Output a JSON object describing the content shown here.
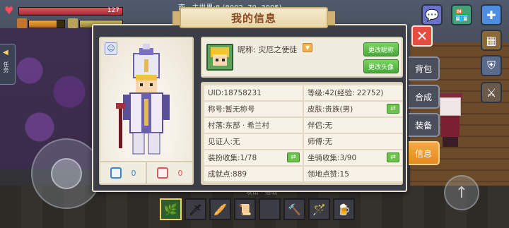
{
  "hud": {
    "hp_value": "127",
    "world_text": "南 · 主世界:8 (8002, 70, 3905)",
    "left_tab_label": "任务",
    "hotbar_label": "攻击 · 拾取"
  },
  "dialog": {
    "title": "我的信息",
    "close_label": "✕"
  },
  "profile": {
    "nickname_label": "昵称:",
    "nickname": "灾厄之使徒",
    "change_nickname_btn": "更改昵称",
    "change_avatar_btn": "更改头像"
  },
  "character": {
    "likes": "0",
    "dislikes": "0"
  },
  "info_left": [
    {
      "label": "UID:",
      "value": "18758231"
    },
    {
      "label": "称号:",
      "value": "暂无称号"
    },
    {
      "label": "村落:",
      "value": "东部 · 希兰村"
    },
    {
      "label": "见证人:",
      "value": "无"
    },
    {
      "label": "装扮收集:",
      "value": "1/78"
    },
    {
      "label": "成就点:",
      "value": "889"
    }
  ],
  "info_right": [
    {
      "label": "等级:",
      "value": "42(经验: 22752)"
    },
    {
      "label": "皮肤:",
      "value": "贵族(男)"
    },
    {
      "label": "伴侣:",
      "value": "无"
    },
    {
      "label": "师傅:",
      "value": "无"
    },
    {
      "label": "坐骑收集:",
      "value": "3/90"
    },
    {
      "label": "领地点赞:",
      "value": "15"
    }
  ],
  "side_tabs": [
    "背包",
    "合成",
    "装备",
    "信息"
  ],
  "colors": {
    "accent_orange": "#e68a1e",
    "close_red": "#e44d3f",
    "button_green": "#49a83b",
    "panel_bg": "#f1ece0"
  },
  "icons": {
    "chat": "chat-bubble-icon",
    "shop": "shop-icon",
    "add": "plus-icon",
    "blocks": "blocks-icon",
    "shield": "shield-icon",
    "swords": "swords-icon"
  }
}
